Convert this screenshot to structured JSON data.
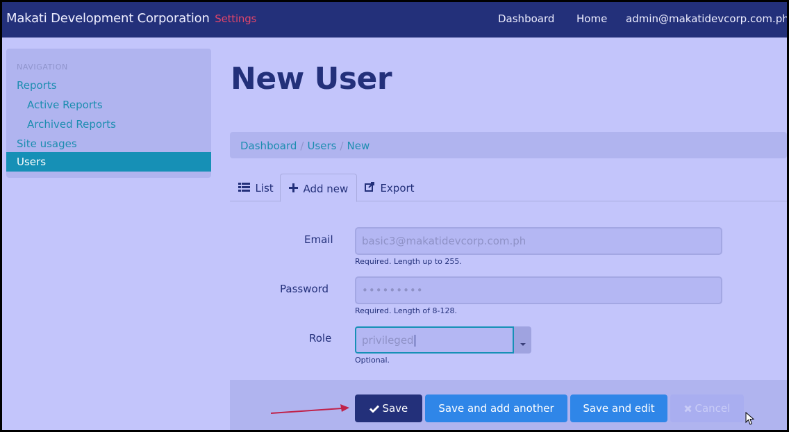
{
  "navbar": {
    "brand": "Makati Development Corporation",
    "brand_accent": "Settings",
    "links": [
      "Dashboard",
      "Home",
      "admin@makatidevcorp.com.ph"
    ]
  },
  "sidebar": {
    "header": "NAVIGATION",
    "items": [
      {
        "label": "Reports"
      },
      {
        "label": "Active Reports"
      },
      {
        "label": "Archived Reports"
      },
      {
        "label": "Site usages"
      },
      {
        "label": "Users",
        "active": true
      }
    ]
  },
  "page": {
    "title": "New User"
  },
  "breadcrumb": [
    "Dashboard",
    "Users",
    "New"
  ],
  "tabs": [
    {
      "label": "List",
      "icon": "list-icon"
    },
    {
      "label": "Add new",
      "icon": "plus-icon",
      "active": true
    },
    {
      "label": "Export",
      "icon": "export-icon"
    }
  ],
  "form": {
    "email": {
      "label": "Email",
      "value": "basic3@makatidevcorp.com.ph",
      "help": "Required. Length up to 255."
    },
    "password": {
      "label": "Password",
      "value": "•••••••••",
      "help": "Required. Length of 8-128."
    },
    "role": {
      "label": "Role",
      "value": "privileged",
      "help": "Optional."
    }
  },
  "actions": {
    "save": "Save",
    "save_add_another": "Save and add another",
    "save_edit": "Save and edit",
    "cancel": "Cancel"
  },
  "colors": {
    "navbar": "#23307a",
    "background": "#c3c5fb",
    "accent": "#1690b6",
    "primary_button": "#2f86e8",
    "annotation_arrow": "#c0224a"
  }
}
